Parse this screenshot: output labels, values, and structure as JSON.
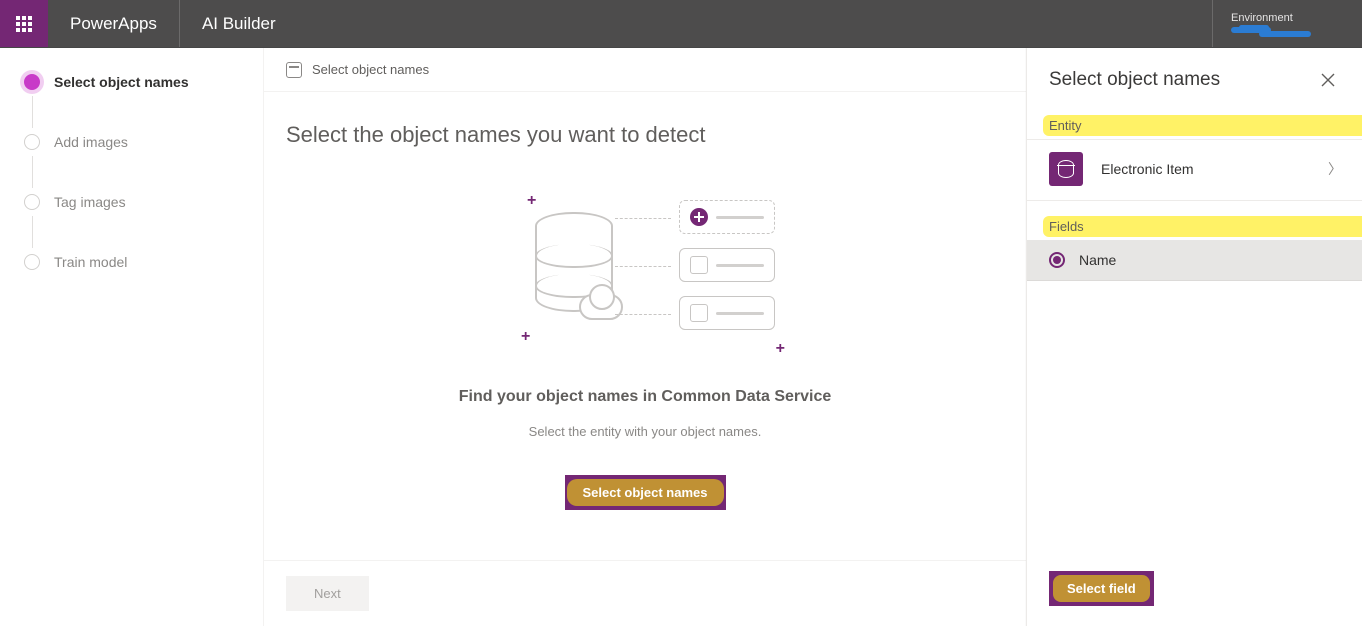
{
  "header": {
    "brand": "PowerApps",
    "section": "AI Builder",
    "env_label": "Environment"
  },
  "steps": [
    {
      "label": "Select object names",
      "active": true
    },
    {
      "label": "Add images",
      "active": false
    },
    {
      "label": "Tag images",
      "active": false
    },
    {
      "label": "Train model",
      "active": false
    }
  ],
  "crumb": "Select object names",
  "main": {
    "title": "Select the object names you want to detect",
    "cta_title": "Find your object names in Common Data Service",
    "cta_sub": "Select the entity with your object names.",
    "select_btn": "Select object names",
    "next_btn": "Next"
  },
  "panel": {
    "title": "Select object names",
    "entity_label": "Entity",
    "entity_value": "Electronic Item",
    "fields_label": "Fields",
    "fields": [
      {
        "label": "Name",
        "selected": true
      }
    ],
    "select_field_btn": "Select field"
  }
}
